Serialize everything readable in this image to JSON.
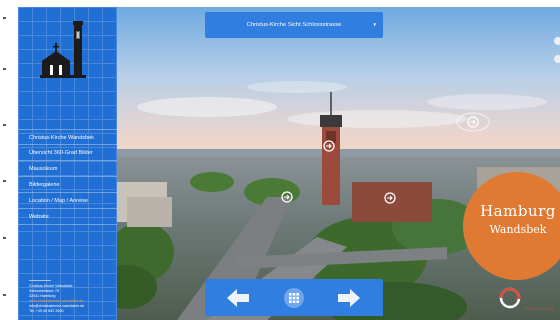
{
  "window": {
    "title": "Christus-Kirche Sicht Schlossstrasse"
  },
  "sidebar": {
    "logo_icon": "church-logo-icon",
    "items": [
      {
        "label": "Christus-Kirche Wandsbek"
      },
      {
        "label": "Übersicht 360-Grad Bilder"
      },
      {
        "label": "Mausoleum"
      },
      {
        "label": "Bildergalerie"
      },
      {
        "label": "Location / Map / Anreise"
      },
      {
        "label": "Website"
      }
    ],
    "address": {
      "name": "Christus-Kirche Wandsbek",
      "street": "Schlossstrasse 78",
      "city": "22041 Hamburg",
      "website": "www.christuskirche-wandsbek.de",
      "email": "info@christuskirche-wandsbek.de",
      "phone": "Tel: +49 40 652 2690"
    }
  },
  "viewer": {
    "select": {
      "value": "Christus-Kirche Sicht Schlossstrasse",
      "caret_icon": "caret-down-icon"
    },
    "nav": {
      "prev_icon": "arrow-left-icon",
      "grid_icon": "grid-icon",
      "next_icon": "arrow-right-icon"
    },
    "badge": {
      "line1": "Hamburg",
      "line2": "Wandsbek"
    },
    "watermark": "VIRTUAL TOUR",
    "hotspot_icon": "link-arrow-icon"
  },
  "colors": {
    "sidebar": "#1f6fd4",
    "panel": "#2f7ee0",
    "badge": "#e07a32",
    "text": "#ffffff"
  }
}
